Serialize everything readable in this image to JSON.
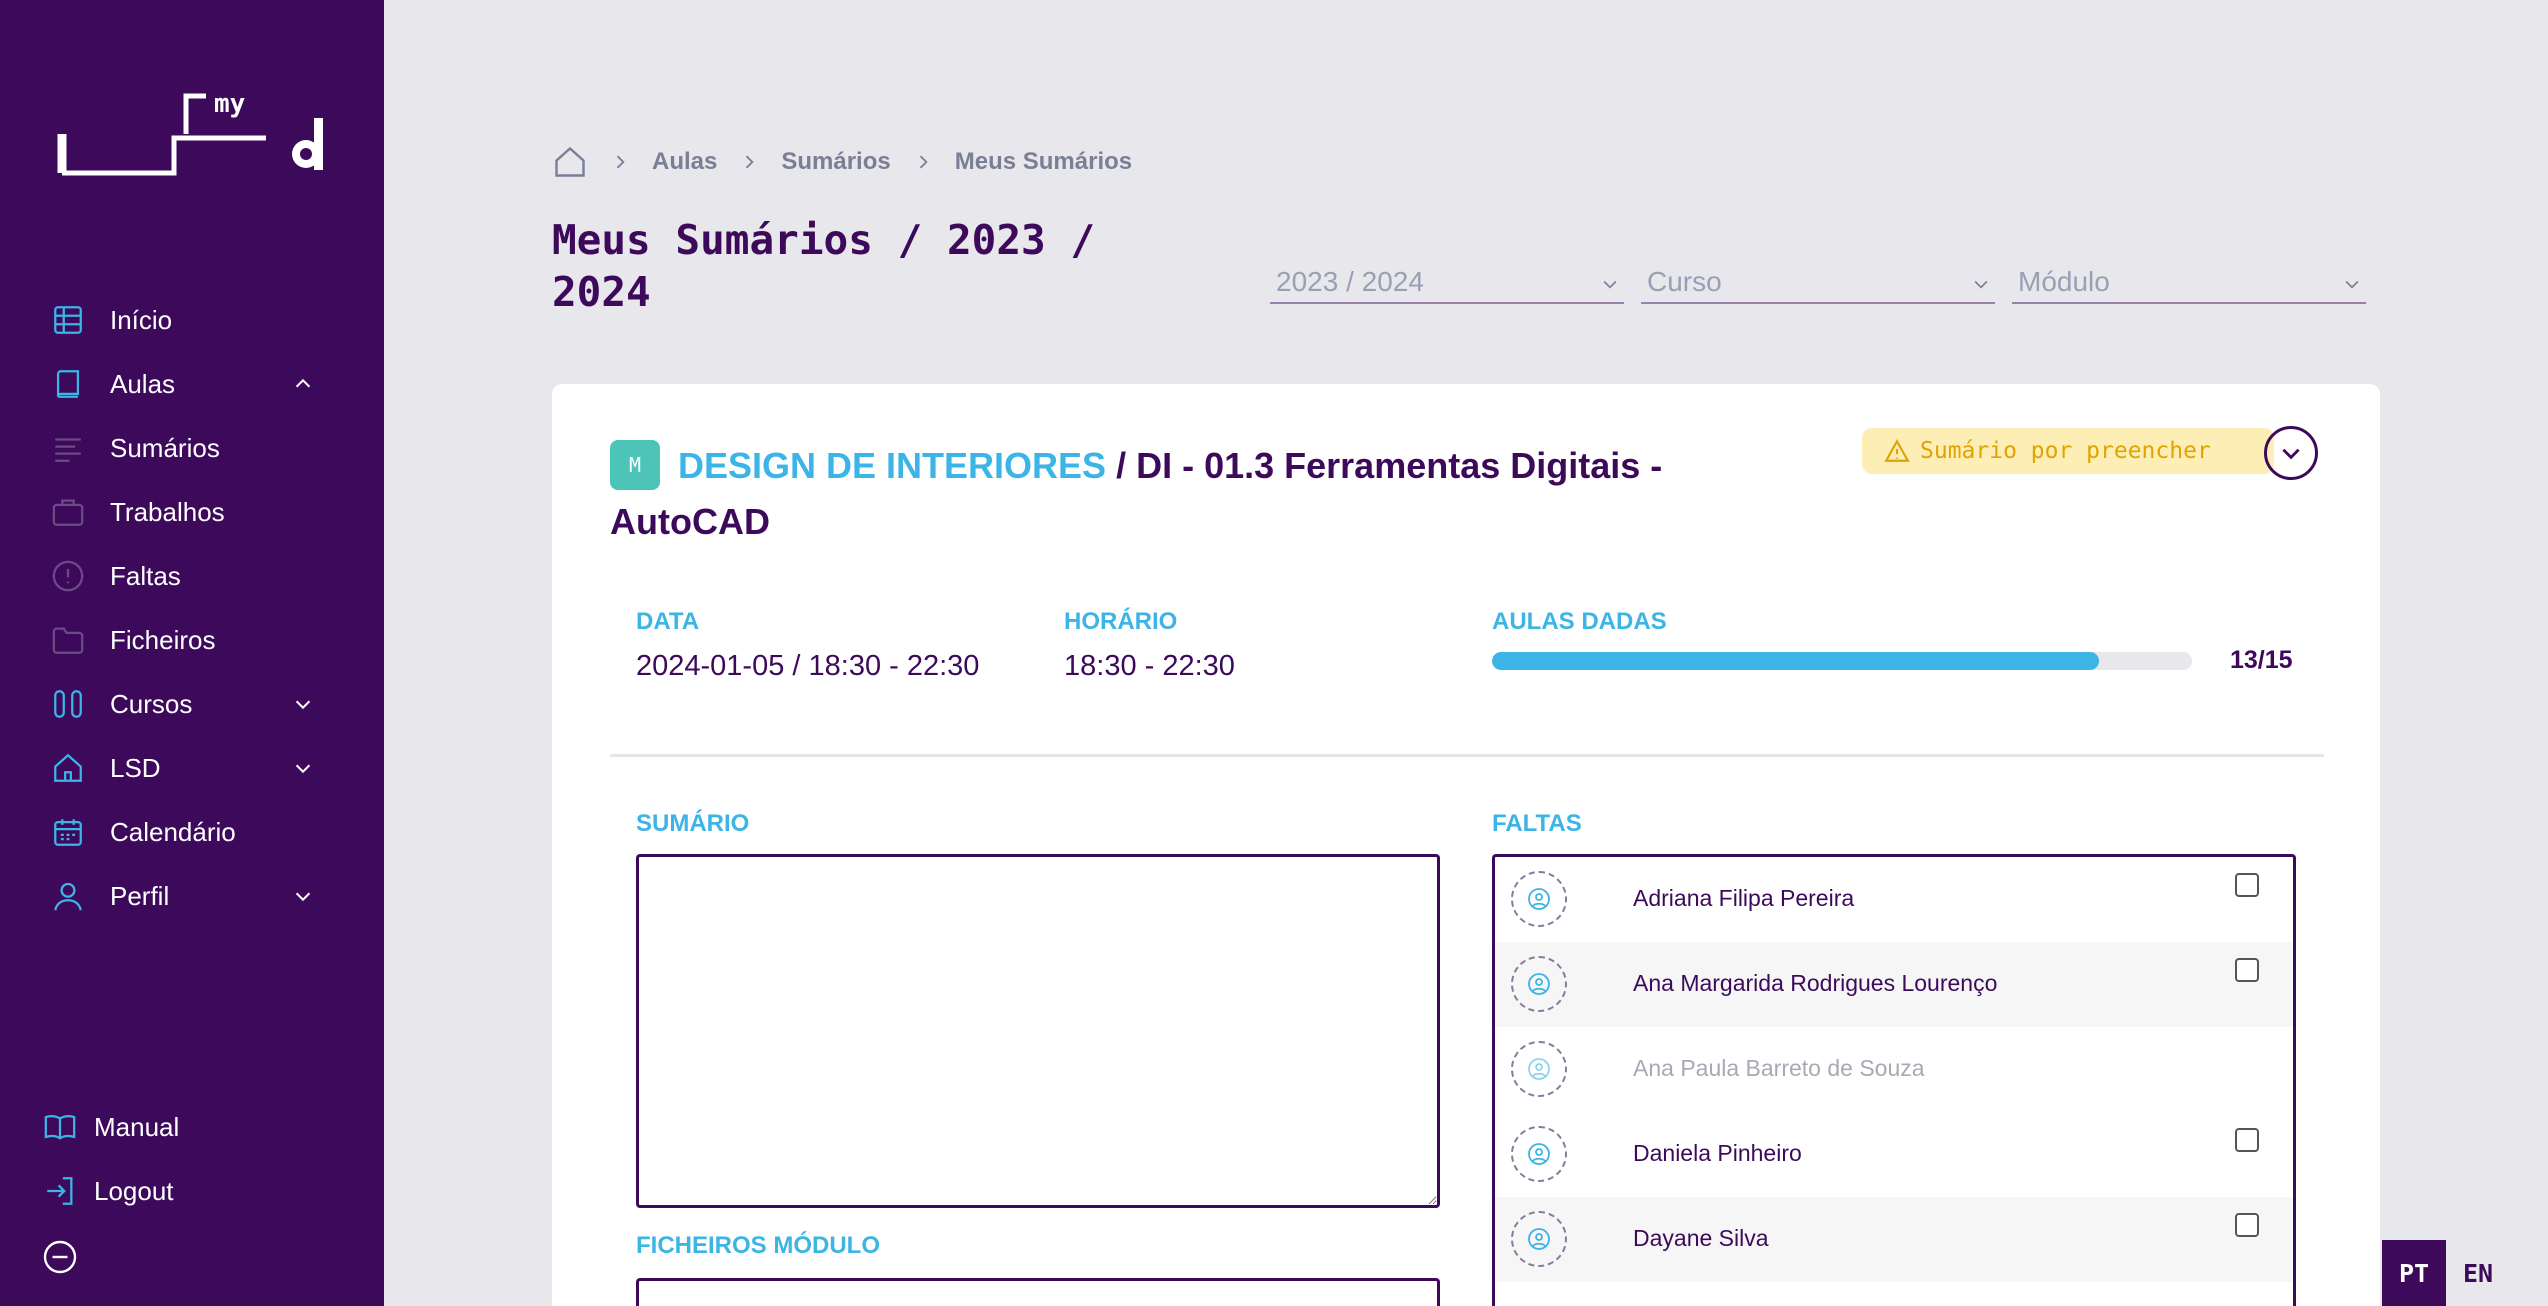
{
  "app": {
    "logo_text": "my"
  },
  "sidebar": {
    "items": [
      {
        "label": "Início",
        "icon": "grid-icon"
      },
      {
        "label": "Aulas",
        "icon": "book-icon"
      },
      {
        "label": "Sumários",
        "icon": "lines-icon"
      },
      {
        "label": "Trabalhos",
        "icon": "briefcase-icon"
      },
      {
        "label": "Faltas",
        "icon": "alert-circle-icon"
      },
      {
        "label": "Ficheiros",
        "icon": "folder-icon"
      },
      {
        "label": "Cursos",
        "icon": "columns-icon"
      },
      {
        "label": "LSD",
        "icon": "home-icon"
      },
      {
        "label": "Calendário",
        "icon": "calendar-icon"
      },
      {
        "label": "Perfil",
        "icon": "user-icon"
      }
    ],
    "bottom": [
      {
        "label": "Manual",
        "icon": "open-book-icon"
      },
      {
        "label": "Logout",
        "icon": "logout-icon"
      }
    ]
  },
  "breadcrumb": [
    "Aulas",
    "Sumários",
    "Meus Sumários"
  ],
  "page": {
    "title": "Meus Sumários / 2023 / 2024"
  },
  "filters": {
    "year": "2023 / 2024",
    "course": "Curso",
    "module": "Módulo"
  },
  "card": {
    "badge": "M",
    "course": "DESIGN DE INTERIORES",
    "separator": " / ",
    "module": "DI - 01.3 Ferramentas Digitais - AutoCAD",
    "status": "Sumário por preencher",
    "data_label": "DATA",
    "data_value": "2024-01-05 / 18:30 - 22:30",
    "horario_label": "HORÁRIO",
    "horario_value": "18:30 - 22:30",
    "aulas_label": "AULAS DADAS",
    "aulas_value": "13/15",
    "aulas_progress": 0.867,
    "sumario_label": "SUMÁRIO",
    "sumario_value": "",
    "ficheiros_label": "FICHEIROS MÓDULO",
    "faltas_label": "FALTAS"
  },
  "students": [
    {
      "name": "Adriana Filipa Pereira",
      "enabled": true
    },
    {
      "name": "Ana Margarida Rodrigues Lourenço",
      "enabled": true
    },
    {
      "name": "Ana Paula Barreto de Souza",
      "enabled": false
    },
    {
      "name": "Daniela Pinheiro",
      "enabled": true
    },
    {
      "name": "Dayane Silva",
      "enabled": true
    }
  ],
  "language": {
    "pt": "PT",
    "en": "EN",
    "active": "PT"
  },
  "colors": {
    "primary": "#3d0a5b",
    "accent": "#3cb4e6",
    "warning": "#e0a400",
    "teal": "#4cc4b8"
  }
}
